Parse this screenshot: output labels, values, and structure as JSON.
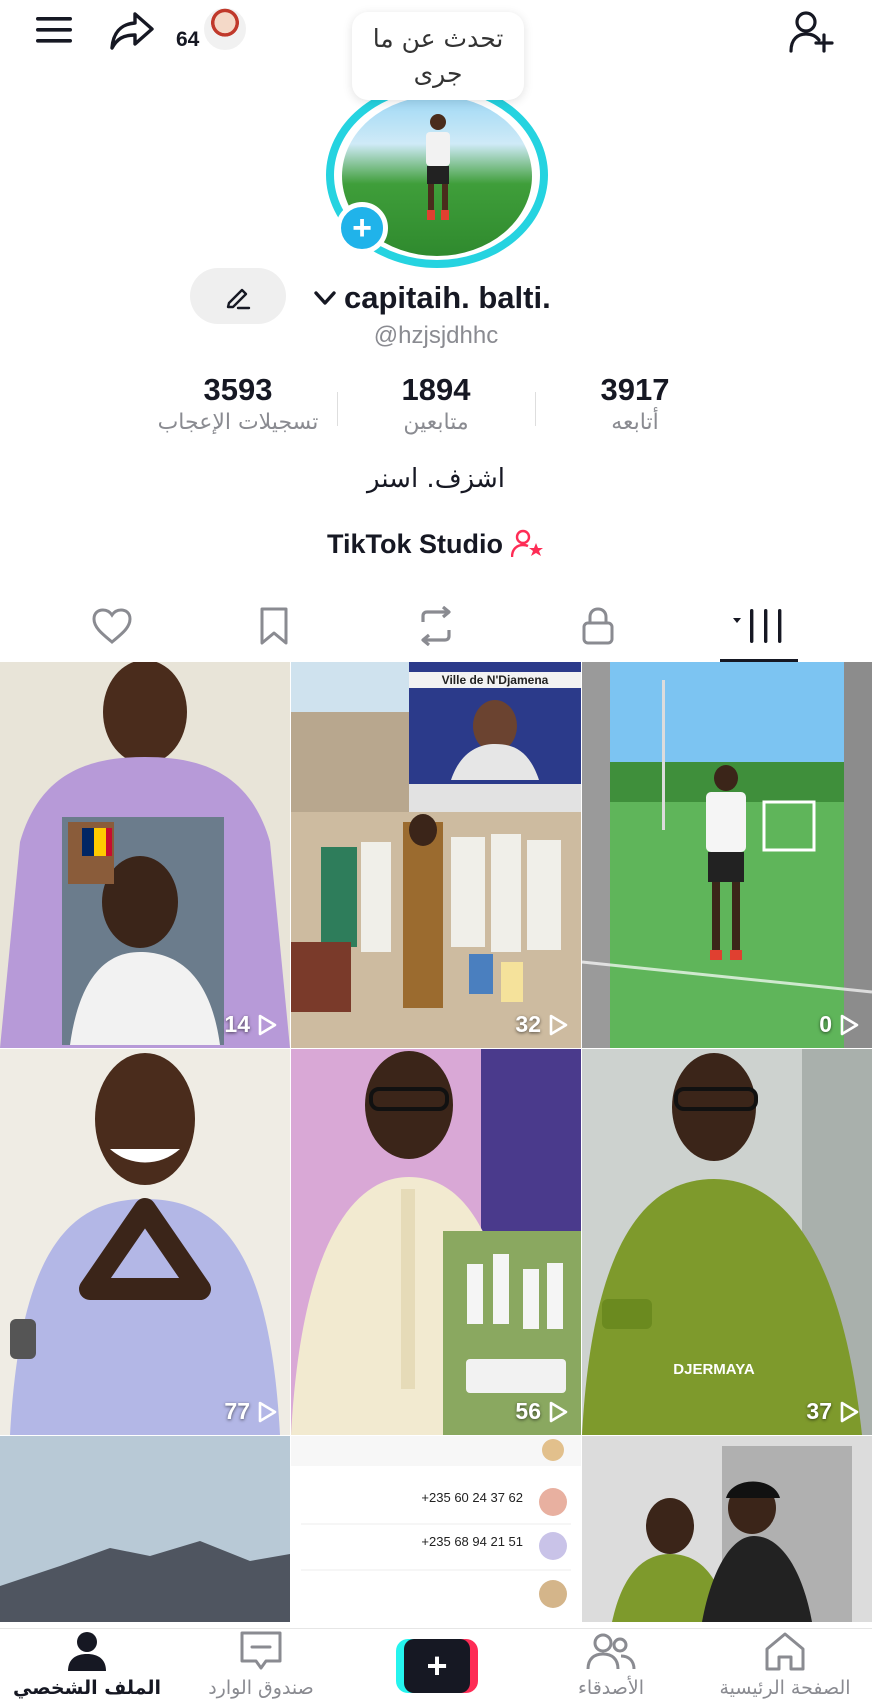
{
  "header": {
    "visitor_count": "64",
    "note_bubble": "تحدث عن ما جرى"
  },
  "profile": {
    "display_name": "capitaih. balti.",
    "handle": "@hzjsjdhhc",
    "bio": "اشزف. اسنر",
    "studio_label": "TikTok Studio"
  },
  "stats": [
    {
      "value": "3917",
      "label": "أتابعه"
    },
    {
      "value": "1894",
      "label": "متابعين"
    },
    {
      "value": "3593",
      "label": "تسجيلات الإعجاب"
    }
  ],
  "tabs": [
    {
      "icon": "liked-heart-icon",
      "active": false
    },
    {
      "icon": "favorites-bookmark-icon",
      "active": false
    },
    {
      "icon": "reposts-icon",
      "active": false
    },
    {
      "icon": "private-lock-icon",
      "active": false
    },
    {
      "icon": "videos-grid-icon",
      "active": true
    }
  ],
  "videos": [
    {
      "views": "14",
      "tile": "purple-robe-person"
    },
    {
      "views": "32",
      "tile": "group-outdoor-ville-de-ndjamena"
    },
    {
      "views": "0",
      "tile": "football-field-player"
    },
    {
      "views": "77",
      "tile": "smiling-hands-triangle"
    },
    {
      "views": "56",
      "tile": "glasses-white-robe"
    },
    {
      "views": "37",
      "tile": "green-robe-car-djermaya"
    },
    {
      "views": "",
      "tile": "mountain-sky"
    },
    {
      "views": "",
      "tile": "chat-screenshot"
    },
    {
      "views": "",
      "tile": "two-men-doorway"
    }
  ],
  "tile_text": {
    "tile2_banner": "Ville de N'Djamena",
    "tile6_caption": "DJERMAYA",
    "tile8_phone1": "+235 60 24 37 62",
    "tile8_phone2": "+235 68 94 21 51"
  },
  "bottom_nav": [
    {
      "label": "الصفحة الرئيسية",
      "icon": "home-icon"
    },
    {
      "label": "الأصدقاء",
      "icon": "friends-icon"
    },
    {
      "label": "",
      "icon": "create-plus-icon"
    },
    {
      "label": "صندوق الوارد",
      "icon": "inbox-icon"
    },
    {
      "label": "الملف الشخصي",
      "icon": "profile-icon",
      "active": true
    }
  ],
  "colors": {
    "avatar_ring": "#25d3e0",
    "avatar_plus": "#20b3ea",
    "studio_icon": "#fe2c55"
  }
}
